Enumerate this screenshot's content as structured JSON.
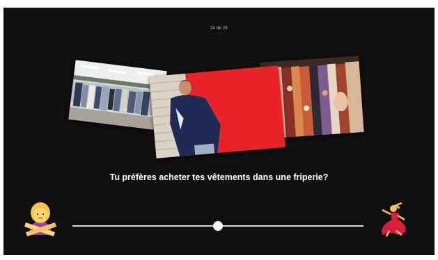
{
  "quiz": {
    "counter": "24 de 25",
    "question": "Tu préfères acheter tes vêtements dans une friperie?",
    "photos": [
      {
        "icon": "thrift-store-interior-photo"
      },
      {
        "icon": "man-red-wall-photo"
      },
      {
        "icon": "clothes-rack-photo"
      }
    ]
  },
  "slider": {
    "value": 0.5,
    "left_icon": "person-gesturing-no-icon",
    "right_icon": "woman-dancing-icon"
  },
  "colors": {
    "background": "#101010",
    "text": "#ffffff",
    "track": "#d9d9d9",
    "accent_red": "#e82428"
  }
}
